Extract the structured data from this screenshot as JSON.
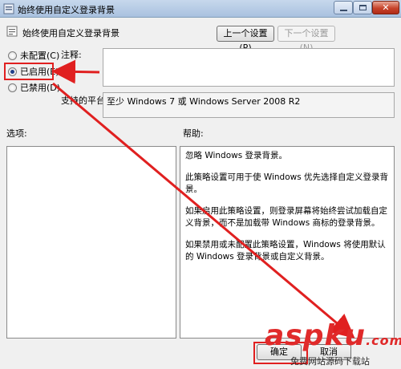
{
  "window": {
    "title": "始终使用自定义登录背景",
    "close_label": "✕"
  },
  "header": {
    "policy_title": "始终使用自定义登录背景",
    "prev_button": "上一个设置(P)",
    "next_button": "下一个设置(N)"
  },
  "options": {
    "not_configured": "未配置(C)",
    "enabled": "已启用(E)",
    "disabled": "已禁用(D)",
    "selected": "enabled"
  },
  "comment": {
    "label": "注释:",
    "value": ""
  },
  "platform": {
    "label": "支持的平台:",
    "value": "至少 Windows 7 或 Windows Server 2008 R2"
  },
  "sections": {
    "options_label": "选项:",
    "help_label": "帮助:"
  },
  "help": {
    "paragraphs": [
      "忽略 Windows 登录背景。",
      "此策略设置可用于使 Windows 优先选择自定义登录背景。",
      "如果启用此策略设置，则登录屏幕将始终尝试加载自定义背景，而不是加载带 Windows 商标的登录背景。",
      "如果禁用或未配置此策略设置，Windows 将使用默认的 Windows 登录背景或自定义背景。"
    ]
  },
  "footer": {
    "ok_button": "确定",
    "cancel_button": "取消"
  },
  "watermark": {
    "brand": "aspku",
    "suffix": ".com",
    "subtitle": "免费网站源码下载站"
  },
  "annotation_color": "#e02020"
}
